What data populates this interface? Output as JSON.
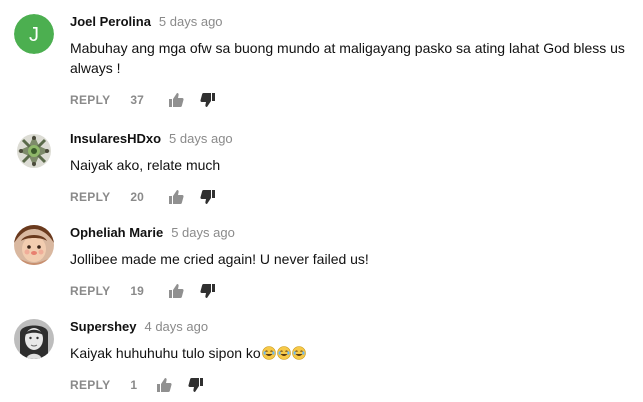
{
  "comments": [
    {
      "avatar_icon": "letter-avatar-icon",
      "avatar_letter": "J",
      "avatar_color": "#4caf50",
      "author": "Joel Perolina",
      "time": "5 days ago",
      "text": "Mabuhay ang mga ofw sa buong mundo at maligayang pasko sa ating lahat  God bless us always !",
      "reply_label": "REPLY",
      "likes": "37"
    },
    {
      "avatar_icon": "ornament-avatar-icon",
      "author": "InsularesHDxo",
      "time": "5 days ago",
      "text": "Naiyak ako, relate much",
      "reply_label": "REPLY",
      "likes": "20"
    },
    {
      "avatar_icon": "girl-photo-avatar-icon",
      "author": "Opheliah Marie",
      "time": "5 days ago",
      "text": "Jollibee made me cried again! U never failed us!",
      "reply_label": "REPLY",
      "likes": "19"
    },
    {
      "avatar_icon": "woman-photo-avatar-icon",
      "author": "Supershey",
      "time": "4 days ago",
      "text": "Kaiyak huhuhuhu tulo sipon ko",
      "text_emoji": "laughing-crying-emoji-icon",
      "reply_label": "REPLY",
      "likes": "1"
    }
  ],
  "icons": {
    "like": "thumbs-up-icon",
    "dislike": "thumbs-down-icon"
  },
  "colors": {
    "meta_gray": "#8a8a8a",
    "text": "#111111"
  }
}
